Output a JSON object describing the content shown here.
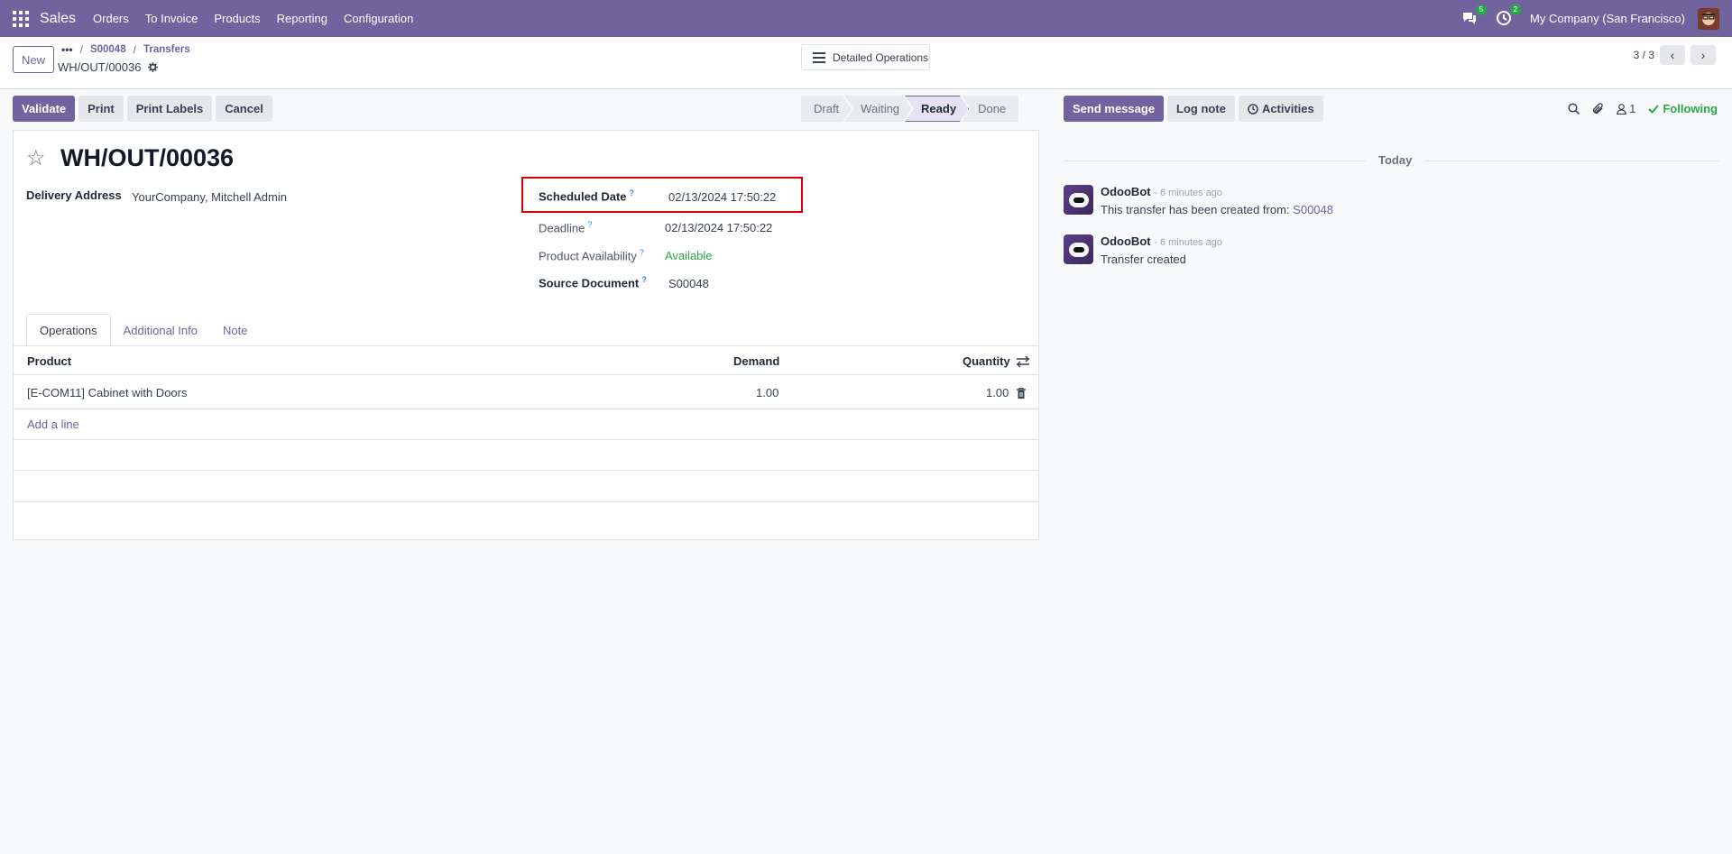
{
  "topbar": {
    "app_name": "Sales",
    "menu": [
      "Orders",
      "To Invoice",
      "Products",
      "Reporting",
      "Configuration"
    ],
    "messages_badge": "5",
    "activities_badge": "2",
    "company": "My Company (San Francisco)"
  },
  "control_panel": {
    "new_label": "New",
    "breadcrumb": [
      "S00048",
      "Transfers"
    ],
    "record_name": "WH/OUT/00036",
    "detailed_operations_label": "Detailed Operations",
    "pager": "3 / 3"
  },
  "status_bar": {
    "buttons": [
      "Validate",
      "Print",
      "Print Labels",
      "Cancel"
    ],
    "stages": [
      "Draft",
      "Waiting",
      "Ready",
      "Done"
    ],
    "active_stage": "Ready"
  },
  "form": {
    "title": "WH/OUT/00036",
    "delivery_address_label": "Delivery Address",
    "delivery_address": "YourCompany, Mitchell Admin",
    "scheduled_date_label": "Scheduled Date",
    "scheduled_date": "02/13/2024 17:50:22",
    "deadline_label": "Deadline",
    "deadline": "02/13/2024 17:50:22",
    "availability_label": "Product Availability",
    "availability": "Available",
    "source_document_label": "Source Document",
    "source_document": "S00048",
    "help_marker": "?",
    "tabs": [
      "Operations",
      "Additional Info",
      "Note"
    ],
    "table": {
      "headers": [
        "Product",
        "Demand",
        "Quantity"
      ],
      "rows": [
        {
          "product": "[E-COM11] Cabinet with Doors",
          "demand": "1.00",
          "quantity": "1.00"
        }
      ],
      "add_line": "Add a line"
    }
  },
  "chatter": {
    "send_message": "Send message",
    "log_note": "Log note",
    "activities": "Activities",
    "followers_count": "1",
    "following": "Following",
    "day_separator": "Today",
    "messages": [
      {
        "author": "OdooBot",
        "when": "- 6 minutes ago",
        "body": "This transfer has been created from:",
        "link": "S00048"
      },
      {
        "author": "OdooBot",
        "when": "- 6 minutes ago",
        "body": "Transfer created",
        "link": ""
      }
    ]
  },
  "colors": {
    "brand": "#71639e",
    "success": "#28a745",
    "highlight": "#dd0000"
  }
}
